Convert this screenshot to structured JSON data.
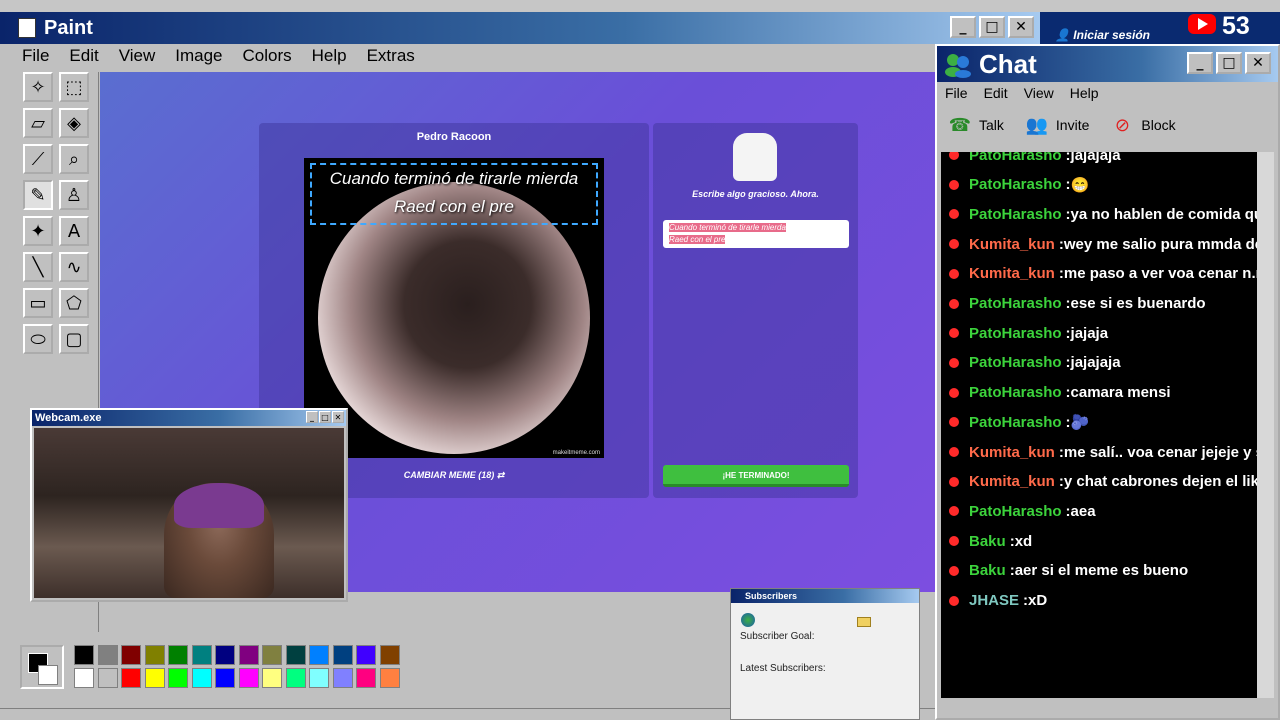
{
  "paint": {
    "title": "Paint",
    "menu": [
      "File",
      "Edit",
      "View",
      "Image",
      "Colors",
      "Help",
      "Extras"
    ],
    "minimize": "_",
    "maximize": "□",
    "close": "✕"
  },
  "meme": {
    "author": "Pedro Racoon",
    "caption_line1": "Cuando terminó de tirarle mierda",
    "caption_line2": "Raed con el pre",
    "watermark": "makeitmeme.com",
    "change_label": "CAMBIAR MEME (18)"
  },
  "write": {
    "prompt": "Escribe algo gracioso. Ahora.",
    "input_line1": "Cuando terminó de tirarle mierda",
    "input_line2": "Raed con el pre",
    "done_label": "¡HE TERMINADO!"
  },
  "webcam": {
    "title": "Webcam.exe"
  },
  "subscribers": {
    "title": "Subscribers",
    "goal_label": "Subscriber Goal:",
    "latest_label": "Latest Subscribers:"
  },
  "topbar": {
    "login": "Iniciar sesión",
    "viewer_count": "53"
  },
  "chat": {
    "title": "Chat",
    "menu": [
      "File",
      "Edit",
      "View",
      "Help"
    ],
    "toolbar": [
      "Talk",
      "Invite",
      "Block"
    ],
    "messages": [
      {
        "user": "PatoHarasho",
        "text": "jajajaja",
        "color": "#3cd33c"
      },
      {
        "user": "PatoHarasho",
        "text": "😁",
        "color": "#3cd33c"
      },
      {
        "user": "PatoHarasho",
        "text": "ya no hablen de comida que n",
        "color": "#3cd33c"
      },
      {
        "user": "Kumita_kun",
        "text": "wey me salio pura mmda de in",
        "color": "#ff6a4a"
      },
      {
        "user": "Kumita_kun",
        "text": "me paso a ver voa cenar n.n",
        "color": "#ff6a4a"
      },
      {
        "user": "PatoHarasho",
        "text": "ese si es buenardo",
        "color": "#3cd33c"
      },
      {
        "user": "PatoHarasho",
        "text": "jajaja",
        "color": "#3cd33c"
      },
      {
        "user": "PatoHarasho",
        "text": "jajajaja",
        "color": "#3cd33c"
      },
      {
        "user": "PatoHarasho",
        "text": "camara mensi",
        "color": "#3cd33c"
      },
      {
        "user": "PatoHarasho",
        "text": "🫐",
        "color": "#3cd33c"
      },
      {
        "user": "Kumita_kun",
        "text": "me salí.. voa cenar jejeje y sig",
        "color": "#ff6a4a"
      },
      {
        "user": "Kumita_kun",
        "text": "y chat cabrones dejen el like",
        "color": "#ff6a4a"
      },
      {
        "user": "PatoHarasho",
        "text": "aea",
        "color": "#3cd33c"
      },
      {
        "user": "Baku",
        "text": "xd",
        "color": "#3cd33c"
      },
      {
        "user": "Baku",
        "text": "aer si el meme es bueno",
        "color": "#3cd33c"
      },
      {
        "user": "JHASE",
        "text": "xD",
        "color": "#7fc8c0"
      }
    ]
  },
  "palette": [
    "#000000",
    "#808080",
    "#800000",
    "#808000",
    "#008000",
    "#008080",
    "#000080",
    "#800080",
    "#808040",
    "#004040",
    "#0080ff",
    "#004080",
    "#4000ff",
    "#804000",
    "#ffffff",
    "#c0c0c0",
    "#ff0000",
    "#ffff00",
    "#00ff00",
    "#00ffff",
    "#0000ff",
    "#ff00ff",
    "#ffff80",
    "#00ff80",
    "#80ffff",
    "#8080ff",
    "#ff0080",
    "#ff8040"
  ]
}
